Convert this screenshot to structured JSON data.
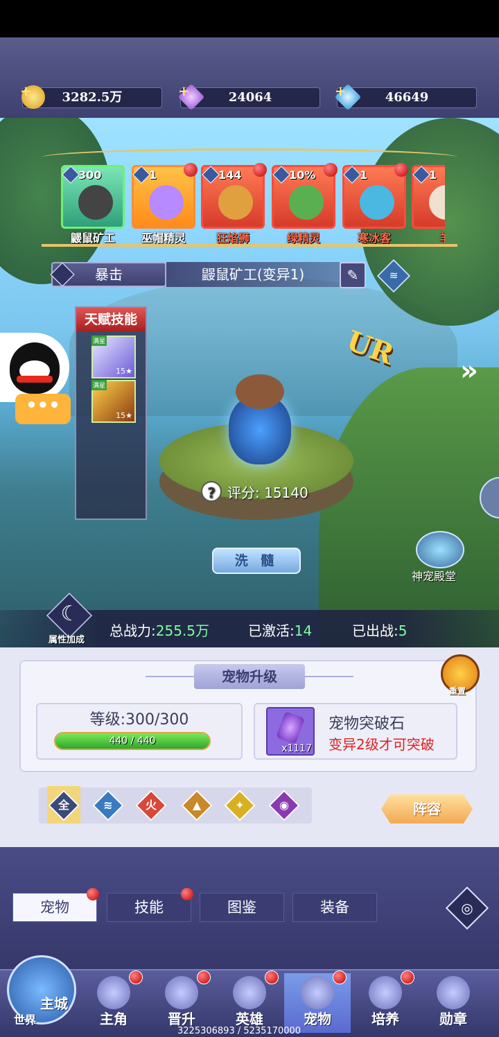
{
  "currency": [
    {
      "icon": "gold-coin-icon",
      "value": "3282.5万",
      "color": "#f5c542"
    },
    {
      "icon": "rainbow-diamond-icon",
      "value": "24064",
      "color": "#c98af5"
    },
    {
      "icon": "blue-diamond-icon",
      "value": "46649",
      "color": "#6ec8ff"
    }
  ],
  "pets": [
    {
      "level": "300",
      "name": "鼹鼠矿工",
      "style": "g",
      "red_dot": false
    },
    {
      "level": "1",
      "name": "巫帽精灵",
      "style": "o",
      "red_dot": true
    },
    {
      "level": "144",
      "name": "狂焰狮",
      "style": "r",
      "red_dot": true
    },
    {
      "level": "10%",
      "name": "绿精灵",
      "style": "r",
      "red_dot": true
    },
    {
      "level": "1",
      "name": "寒冰客",
      "style": "r",
      "red_dot": true
    },
    {
      "level": "1",
      "name": "羊",
      "style": "r",
      "red_dot": false
    }
  ],
  "attribute": {
    "type": "暴击",
    "pet_name": "鼹鼠矿工(变异1)"
  },
  "talent": {
    "title": "天赋技能",
    "skills": [
      {
        "tag": "满星",
        "stars": "15"
      },
      {
        "tag": "满星",
        "stars": "15"
      }
    ]
  },
  "badge": "UR",
  "score": {
    "label": "评分: 15140"
  },
  "wash_label": "洗 髓",
  "palace_label": "神宠殿堂",
  "stats": {
    "attr_bonus": "属性加成",
    "power_label": "总战力:",
    "power_value": "255.5万",
    "activated_label": "已激活:",
    "activated_value": "14",
    "deployed_label": "已出战:",
    "deployed_value": "5"
  },
  "upgrade": {
    "title": "宠物升级",
    "reset": "重置",
    "level_text": "等级:300/300",
    "exp_text": "440 / 440",
    "exp_fraction": 1.0,
    "stone_count": "x1117",
    "stone_name": "宠物突破石",
    "stone_warning": "变异2级才可突破"
  },
  "filters": [
    {
      "label": "全",
      "color": "#3a4a7a"
    },
    {
      "label": "≋",
      "color": "#3a7ac0"
    },
    {
      "label": "火",
      "color": "#d8483a"
    },
    {
      "label": "▲",
      "color": "#c9882a"
    },
    {
      "label": "✦",
      "color": "#d8b020"
    },
    {
      "label": "◉",
      "color": "#8a3ab0"
    }
  ],
  "lineup_label": "阵容",
  "tabs": [
    {
      "label": "宠物",
      "active": true,
      "dot": true
    },
    {
      "label": "技能",
      "active": false,
      "dot": true
    },
    {
      "label": "图鉴",
      "active": false,
      "dot": false
    },
    {
      "label": "装备",
      "active": false,
      "dot": false
    }
  ],
  "nav": {
    "castle": "主城",
    "world": "世界",
    "items": [
      {
        "label": "主角",
        "dot": true
      },
      {
        "label": "晋升",
        "dot": true
      },
      {
        "label": "英雄",
        "dot": true
      },
      {
        "label": "宠物",
        "dot": true,
        "active": true
      },
      {
        "label": "培养",
        "dot": true
      },
      {
        "label": "勋章",
        "dot": false
      }
    ]
  },
  "coords_text": "3225306893 / 5235170000"
}
